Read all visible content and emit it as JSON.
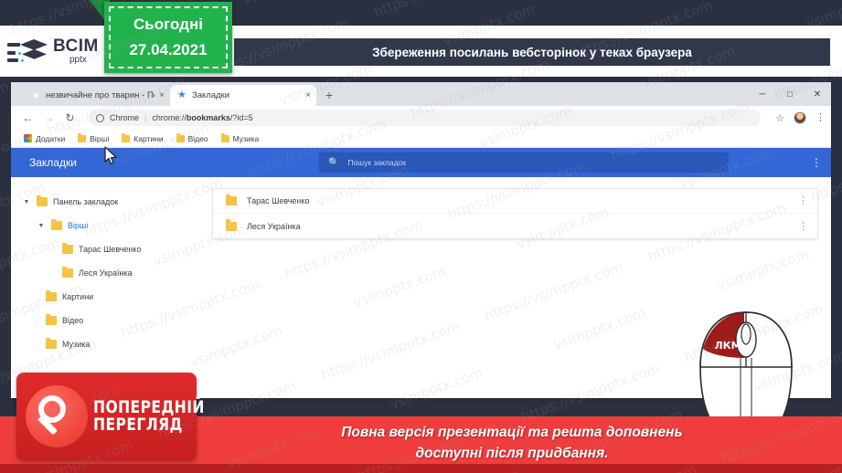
{
  "slide": {
    "date_badge": {
      "label": "Сьогодні",
      "date": "27.04.2021"
    },
    "logo": {
      "name": "ВСІМ",
      "sub": "pptx"
    },
    "title": "Збереження посилань вебсторінок у теках браузера"
  },
  "browser": {
    "tabs": [
      {
        "title": "незвичайне про тварин - Пош",
        "icon": "google-icon",
        "active": false,
        "close": "×"
      },
      {
        "title": "Закладки",
        "icon": "star-icon",
        "active": true,
        "close": "×"
      }
    ],
    "new_tab": "+",
    "window_controls": {
      "minimize": "─",
      "maximize": "□",
      "close": "✕"
    },
    "toolbar": {
      "back": "←",
      "forward": "→",
      "reload": "↻",
      "site_chip": "Chrome",
      "separator": "|",
      "url_prefix": "chrome://",
      "url_bold": "bookmarks",
      "url_suffix": "/?id=5",
      "bookmark_star": "☆",
      "menu": "⋮"
    },
    "bookmarks_bar": [
      {
        "label": "Додатки",
        "icon": "apps-grid-icon"
      },
      {
        "label": "Вірші",
        "icon": "folder-icon"
      },
      {
        "label": "Картини",
        "icon": "folder-icon"
      },
      {
        "label": "Відео",
        "icon": "folder-icon"
      },
      {
        "label": "Музика",
        "icon": "folder-icon"
      }
    ]
  },
  "bookmark_manager": {
    "header_title": "Закладки",
    "search_placeholder": "Пошук закладок",
    "search_icon": "search-icon",
    "header_menu": "⋮",
    "tree": [
      {
        "label": "Панель закладок",
        "indent": 0,
        "expanded": true,
        "selected": false,
        "arrow": "▼"
      },
      {
        "label": "Вірші",
        "indent": 1,
        "expanded": true,
        "selected": true,
        "arrow": "▼"
      },
      {
        "label": "Тарас Шевченко",
        "indent": 2,
        "expanded": false,
        "selected": false,
        "arrow": ""
      },
      {
        "label": "Леся Українка",
        "indent": 2,
        "expanded": false,
        "selected": false,
        "arrow": ""
      },
      {
        "label": "Картини",
        "indent": 1,
        "expanded": false,
        "selected": false,
        "arrow": ""
      },
      {
        "label": "Відео",
        "indent": 1,
        "expanded": false,
        "selected": false,
        "arrow": ""
      },
      {
        "label": "Музика",
        "indent": 1,
        "expanded": false,
        "selected": false,
        "arrow": ""
      }
    ],
    "rows": [
      {
        "label": "Тарас Шевченко",
        "menu": "⋮"
      },
      {
        "label": "Леся Українка",
        "menu": "⋮"
      }
    ]
  },
  "mouse_hint": {
    "button_label": "ЛКМ"
  },
  "footer": {
    "preview_line1": "ПОПЕРЕДНІЙ",
    "preview_line2": "ПЕРЕГЛЯД",
    "notice_line1": "Повна версія презентації та решта доповнень",
    "notice_line2": "доступні після придбання."
  },
  "watermark": {
    "text1": "https://vsimpptx.com",
    "text2": "vsimpptx.com"
  },
  "colors": {
    "dark": "#2b3040",
    "green": "#22b24c",
    "blue": "#3367d6",
    "red": "#ef3d3d",
    "folder": "#f6c344",
    "accent_link": "#1a73e8"
  }
}
